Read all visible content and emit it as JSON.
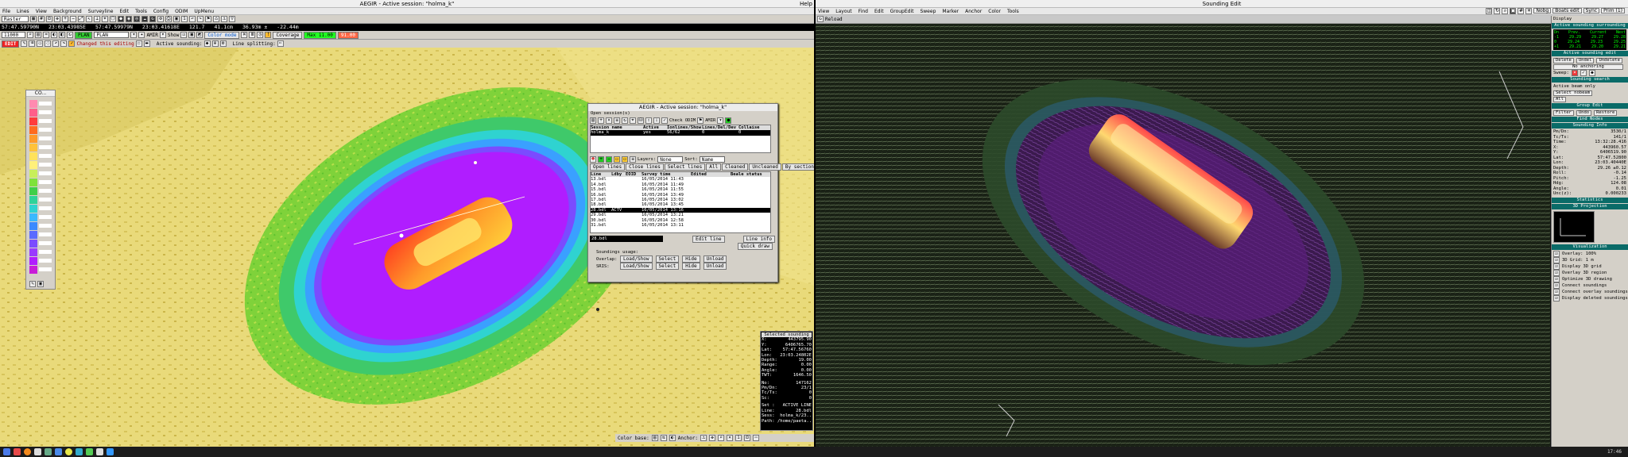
{
  "left_window": {
    "title": "AEGIR - Active session: \"holma_k\"",
    "help": "Help",
    "menu": [
      "File",
      "Lines",
      "View",
      "Background",
      "Surveyline",
      "Edit",
      "Tools",
      "Config",
      "ODIM",
      "UpMenu"
    ],
    "raster_label": "Raster",
    "coords": [
      "57:47.59790N",
      "23:03.43985E",
      "57:47.59979N",
      "23:03.41618E",
      "121.7",
      "41.1cm",
      "36.93m ±",
      "-22.44m"
    ],
    "grid_size": "11000",
    "plan_label": "PLAN",
    "amir_label": "AMIR",
    "show_label": "Show",
    "color_mode": "Color mode",
    "coverage_btn": "Coverage",
    "depth_green": "Max 11.00",
    "depth_red": "91.00",
    "edit_badge": "EDIT",
    "changed_label": "Changed this editing",
    "active_sounding_label": "Active sounding:",
    "line_splitting_label": "Line splitting:"
  },
  "palette": {
    "title": "CO..."
  },
  "session_dialog": {
    "title": "AEGIR - Active session: \"holma_k\"",
    "open_sessions": "Open session(s)",
    "check_odim": "Check ODIM",
    "amir": "AMIR",
    "sess_headers": [
      "Session name",
      "Active",
      "Ionlines/Show",
      "Lines/Del/Dev",
      "Collaise"
    ],
    "sess_row": [
      "holma_k",
      "yes",
      "56/62",
      "0",
      "0"
    ],
    "layers_label": "Layers:",
    "sort_label": "Sort:",
    "sort_value": "Name",
    "none_value": "None",
    "line_buttons": [
      "Open lines",
      "Close lines",
      "Select lines",
      "All",
      "Cleaned",
      "Uncleaned",
      "By section"
    ],
    "line_headers": [
      "Line",
      "Ldby",
      "EOID",
      "Survey time",
      "Edited",
      "Beale status"
    ],
    "lines": [
      [
        "13.bdl",
        "",
        "",
        "16/05/2014 11:43",
        ""
      ],
      [
        "14.bdl",
        "",
        "",
        "16/05/2014 11:49",
        ""
      ],
      [
        "15.bdl",
        "",
        "",
        "16/05/2014 11:55",
        ""
      ],
      [
        "16.bdl",
        "",
        "",
        "16/05/2014 13:49",
        ""
      ],
      [
        "17.bdl",
        "",
        "",
        "16/05/2014 13:02",
        ""
      ],
      [
        "18.bdl",
        "",
        "",
        "16/05/2014 13:45",
        ""
      ],
      [
        "28.bdl",
        "ACTV",
        "",
        "16/05/2014 13:16",
        ""
      ],
      [
        "29.bdl",
        "",
        "",
        "16/05/2014 13:21",
        ""
      ],
      [
        "30.bdl",
        "",
        "",
        "16/05/2014 12:58",
        ""
      ],
      [
        "31.bdl",
        "",
        "",
        "16/05/2014 13:11",
        ""
      ]
    ],
    "selected_index": 6,
    "current_line": "28.bdl",
    "edit_line": "Edit line",
    "line_info": "Line info",
    "quick_draw": "Quick draw",
    "soundings_usage": "Soundings usage:",
    "overlap_label": "Overlap:",
    "ss_label": "SRIS:",
    "load_show": "Load/Show",
    "select": "Select",
    "hide": "Hide",
    "unload": "Unload"
  },
  "selected_sounding": {
    "title": "Selected sounding",
    "rows": [
      [
        "X:",
        "443795.90"
      ],
      [
        "Y:",
        "6406765.70"
      ],
      [
        "Lat:",
        "57:47.56760"
      ],
      [
        "Lon:",
        "23:03.24802E"
      ],
      [
        "Depth:",
        "19.00"
      ],
      [
        "Range:",
        "0.00"
      ],
      [
        "Angle:",
        "0.00"
      ],
      [
        "TWT:",
        "1646.50"
      ]
    ],
    "rows2": [
      [
        "No:",
        "147162"
      ],
      [
        "Pm/Dn:",
        "23/1"
      ],
      [
        "Tc/Ts:",
        "0"
      ],
      [
        "Sc:",
        "0"
      ]
    ],
    "rows3": [
      [
        "Set :",
        "ACTIVE LINE"
      ],
      [
        "Line:",
        "28.bdl"
      ],
      [
        "Sess:",
        "holma_k/23.."
      ],
      [
        "Path:",
        "/home/paeta.."
      ]
    ]
  },
  "color_bar": {
    "label": "Color base:",
    "anchor": "Anchor:"
  },
  "right_window": {
    "title": "Sounding Edit",
    "menu": [
      "View",
      "Layout",
      "Find",
      "Edit",
      "GroupEdit",
      "Sweep",
      "Marker",
      "Anchor",
      "Color",
      "Tools"
    ],
    "reload": "Reload",
    "nobeg": "Nobg",
    "boats": "Boats edit",
    "sync": "Sync",
    "zoom": "Prim (1)",
    "display_label": "Display"
  },
  "side_panel": {
    "sections": [
      "Active sounding surrounding",
      "Active sounding edit",
      "Sounding search",
      "Group Edit",
      "Find Nodes",
      "Sounding Info",
      "Statistics",
      "3D Projection",
      "Visualization"
    ],
    "surround_headers": [
      "Dn",
      "Prev.",
      "Current",
      "Next"
    ],
    "surround_rows": [
      [
        "-1",
        "29.29",
        "29.27",
        "29.28"
      ],
      [
        "0",
        "29.24",
        "29.23",
        "29.25"
      ],
      [
        "+1",
        "29.21",
        "29.20",
        "29.21"
      ]
    ],
    "delete": "Delete",
    "undel": "Undel",
    "undelete": "Undelete",
    "no_anchor": "No anchoring",
    "sweep_label": "Sweep:",
    "select_nobeam": "Select nobeam",
    "active_beam_only": "Active beam only",
    "features_all": "All",
    "filter_btn": "Filter",
    "undo_btn": "Undo",
    "restore_btn": "Restore",
    "info_rows": [
      [
        "Pm/Dn:",
        "3530/1"
      ],
      [
        "Tc/Ts:",
        "141/1"
      ],
      [
        "Time:",
        "13:32:28.416"
      ],
      [
        "X:",
        "443960.57"
      ],
      [
        "Y:",
        "6406519.90"
      ],
      [
        "Lat:",
        "57:47.52800"
      ],
      [
        "Lon:",
        "23:03.40440E"
      ],
      [
        "Depth:",
        "29.26 ±0.12"
      ],
      [
        "Roll:",
        "-0.14"
      ],
      [
        "Pitch:",
        "-1.25"
      ],
      [
        "Hdg:",
        "124.08"
      ],
      [
        "Angle:",
        "0.01"
      ],
      [
        "Unc(z):",
        "0.000233"
      ]
    ],
    "vis_rows": [
      "Overlay: 100%",
      "3D Grid: 1 m",
      "Display 3D grid",
      "Overlay 3D region",
      "Optimize 3D drawing",
      "Connect soundings",
      "Connect overlay soundings",
      "Display deleted soundings"
    ]
  },
  "taskbar": {
    "clock": "17:46"
  }
}
